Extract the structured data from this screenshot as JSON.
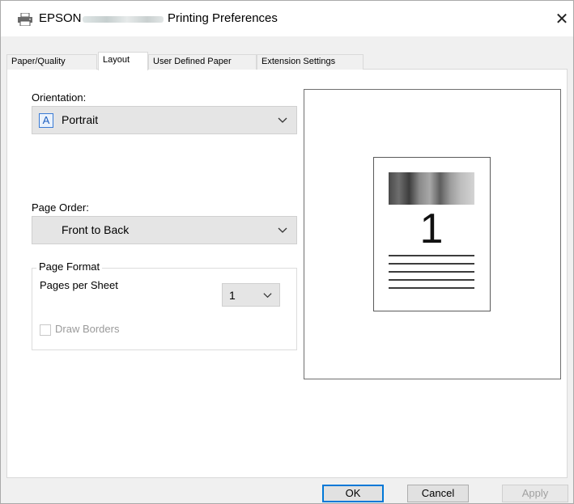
{
  "window": {
    "title_brand": "EPSON",
    "title_rest": "Printing Preferences",
    "close_glyph": "✕"
  },
  "tabs": [
    {
      "label": "Paper/Quality",
      "active": false
    },
    {
      "label": "Layout",
      "active": true
    },
    {
      "label": "User Defined Paper",
      "active": false
    },
    {
      "label": "Extension Settings",
      "active": false
    }
  ],
  "layout": {
    "orientation_label": "Orientation:",
    "orientation_icon_letter": "A",
    "orientation_value": "Portrait",
    "page_order_label": "Page Order:",
    "page_order_value": "Front to Back",
    "page_format_legend": "Page Format",
    "pages_per_sheet_label": "Pages per Sheet",
    "pages_per_sheet_value": "1",
    "draw_borders_label": "Draw Borders",
    "draw_borders_checked": false
  },
  "preview": {
    "page_number": "1",
    "line_count": 5
  },
  "buttons": {
    "ok": "OK",
    "cancel": "Cancel",
    "apply": "Apply"
  },
  "icons": {
    "title": "printer-icon",
    "close": "close-icon",
    "dropdown": "chevron-down-icon",
    "orientation": "portrait-letter-icon"
  },
  "colors": {
    "accent": "#0078d7",
    "window_bg": "#f0f0f0",
    "panel_bg": "#ffffff",
    "combo_bg": "#e5e5e5"
  }
}
